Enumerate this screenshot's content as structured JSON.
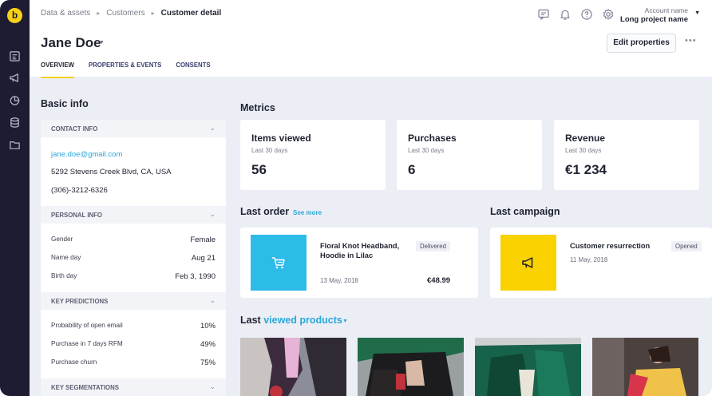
{
  "colors": {
    "rail": "#1e1c33",
    "brand_yellow": "#f7d117",
    "link_blue": "#2aa7d9",
    "order_thumb": "#2dbbe8",
    "campaign_thumb": "#f9d200"
  },
  "rail": {
    "logo": "b",
    "icons": [
      "reports-icon",
      "megaphone-icon",
      "analytics-icon",
      "database-icon",
      "folder-icon"
    ]
  },
  "header": {
    "breadcrumbs": [
      "Data & assets",
      "Customers",
      "Customer detail"
    ],
    "icons": [
      "chat-icon",
      "bell-icon",
      "help-icon",
      "gear-icon"
    ],
    "account_label": "Account name",
    "project_name": "Long project name",
    "customer_name": "Jane Doe",
    "edit_button": "Edit properties",
    "more": "•••",
    "tabs": [
      "OVERVIEW",
      "PROPERTIES & EVENTS",
      "CONSENTS"
    ]
  },
  "basic_info": {
    "title": "Basic info",
    "contact": {
      "header": "CONTACT INFO",
      "email": "jane.doe@gmail.com",
      "address": "5292 Stevens Creek Blvd, CA, USA",
      "phone": "(306)-3212-6326"
    },
    "personal": {
      "header": "PERSONAL INFO",
      "rows": [
        {
          "label": "Gender",
          "value": "Female"
        },
        {
          "label": "Name day",
          "value": "Aug 21"
        },
        {
          "label": "Birth day",
          "value": "Feb 3, 1990"
        }
      ]
    },
    "predictions": {
      "header": "KEY PREDICTIONS",
      "rows": [
        {
          "label": "Probability of open email",
          "value": "10%"
        },
        {
          "label": "Purchase in 7 days RFM",
          "value": "49%"
        },
        {
          "label": "Purchase churn",
          "value": "75%"
        }
      ]
    },
    "segmentations": {
      "header": "KEY SEGMENTATIONS"
    }
  },
  "metrics": {
    "title": "Metrics",
    "cards": [
      {
        "title": "Items viewed",
        "sub": "Last 30 days",
        "value": "56"
      },
      {
        "title": "Purchases",
        "sub": "Last 30 days",
        "value": "6"
      },
      {
        "title": "Revenue",
        "sub": "Last 30 days",
        "value": "€1 234"
      }
    ]
  },
  "last_order": {
    "title": "Last order",
    "see_more": "See more",
    "product_line1": "Floral Knot Headband,",
    "product_line2": "Hoodie in Lilac",
    "status": "Delivered",
    "date": "13 May, 2018",
    "price": "€48.99"
  },
  "last_campaign": {
    "title": "Last campaign",
    "name": "Customer resurrection",
    "status": "Opened",
    "date": "11 May, 2018"
  },
  "last_viewed": {
    "prefix": "Last",
    "accent": "viewed products"
  }
}
